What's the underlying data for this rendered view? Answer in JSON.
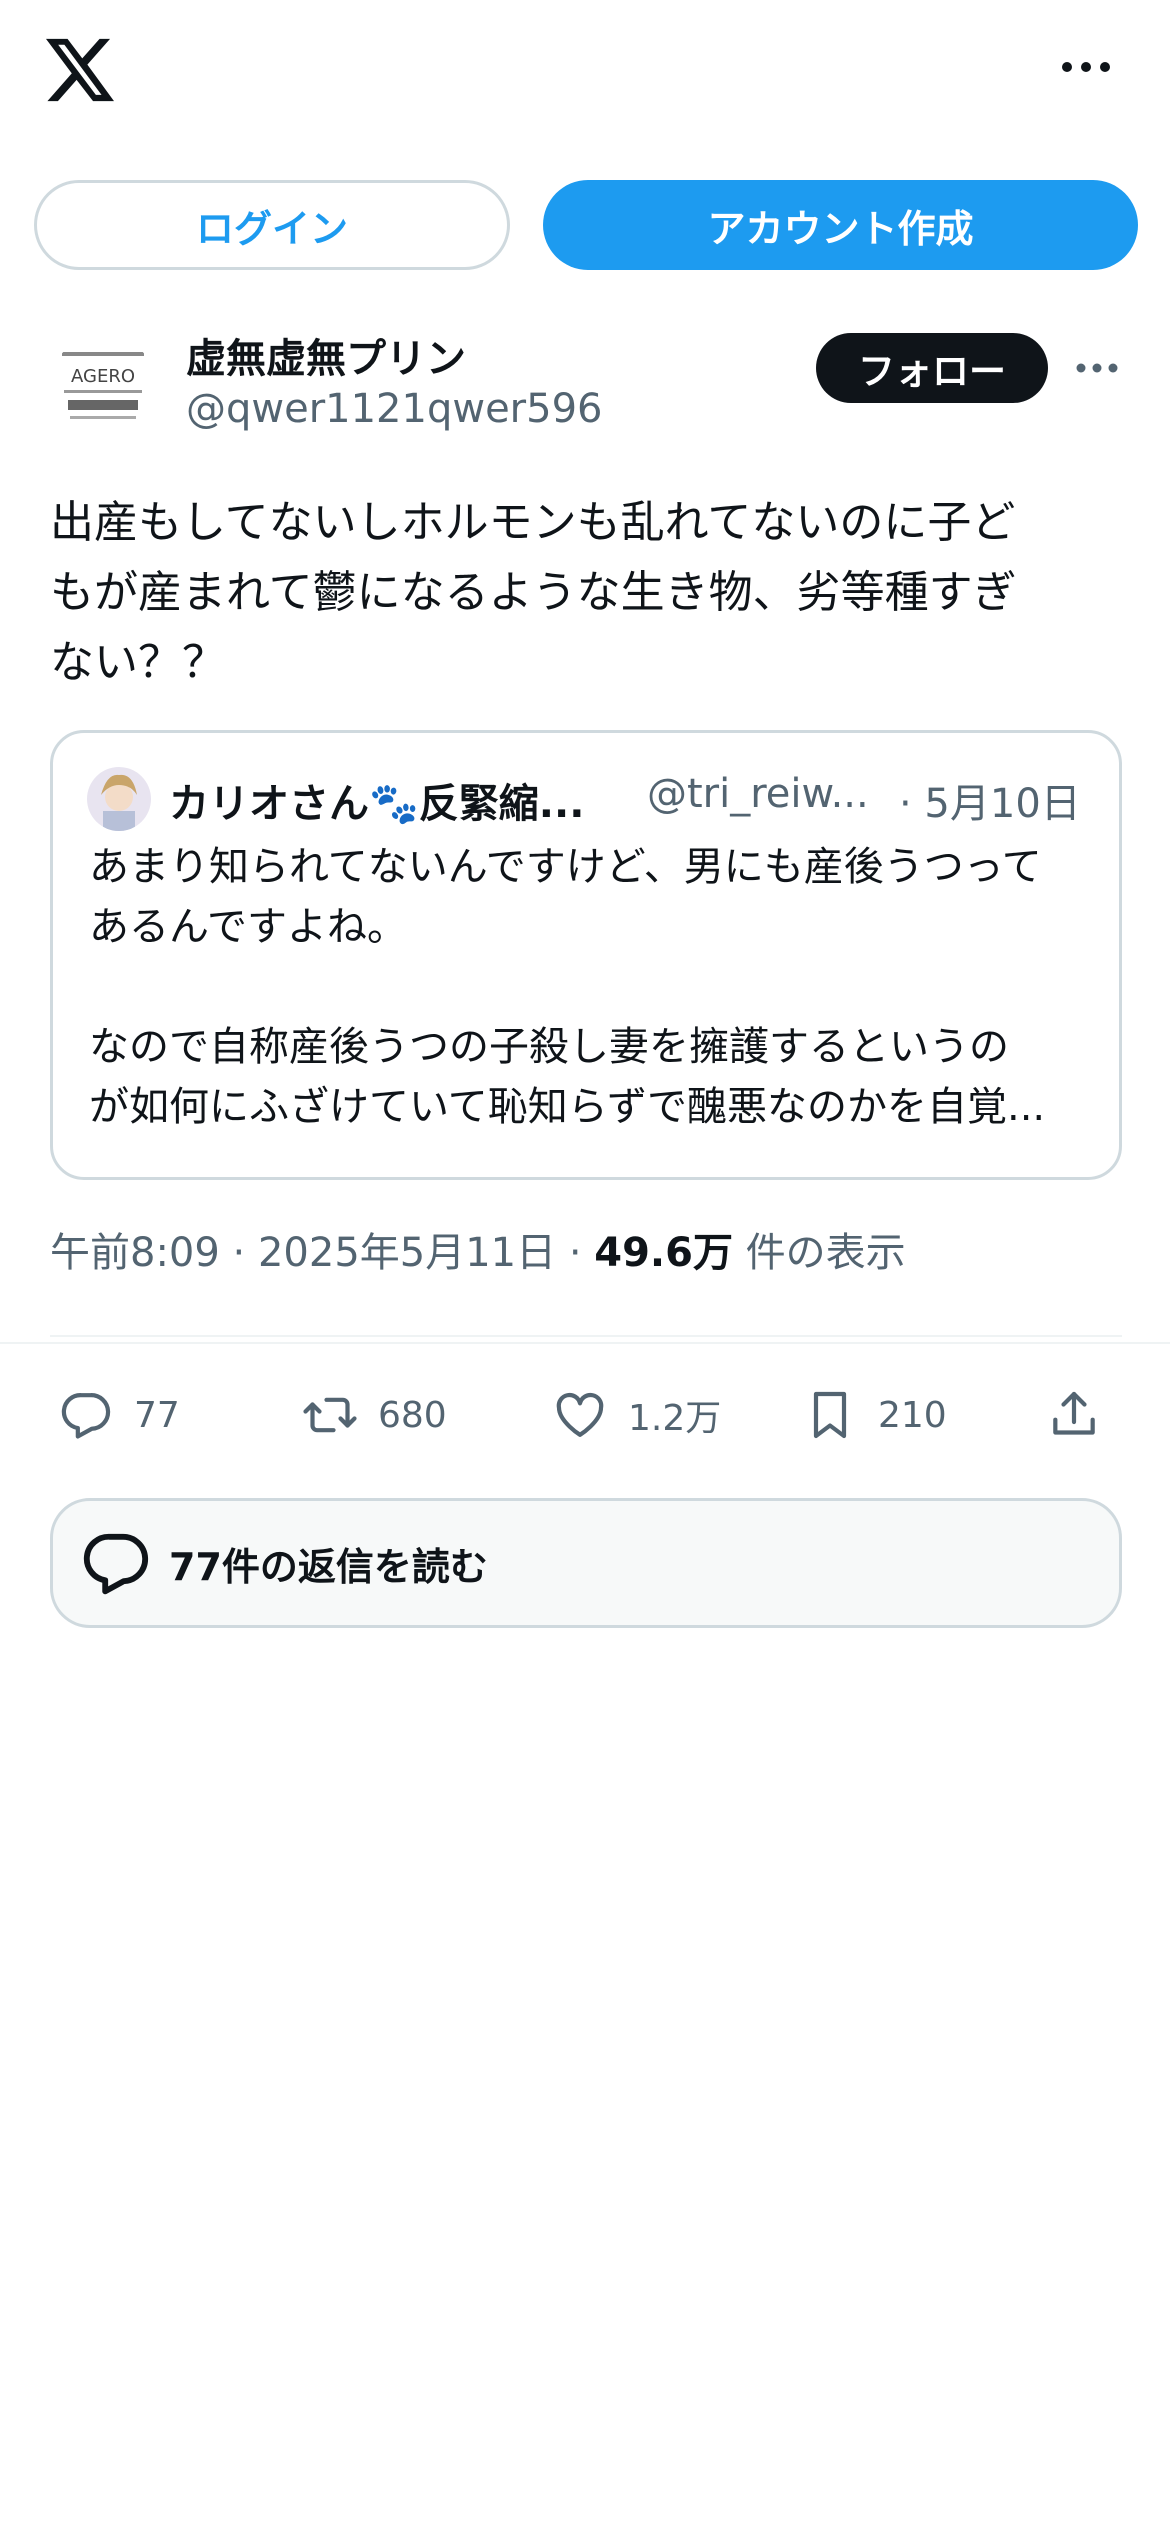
{
  "header": {
    "logo_icon": "x-logo-icon",
    "menu_icon": "more-horizontal-icon"
  },
  "auth": {
    "login_label": "ログイン",
    "signup_label": "アカウント作成"
  },
  "tweet": {
    "avatar_text": "AGERO",
    "author_name": "虚無虚無プリン",
    "author_handle": "@qwer1121qwer596",
    "follow_label": "フォロー",
    "text_lines": [
      "出産もしてないしホルモンも乱れてないのに子ど",
      "もが産まれて鬱になるような生き物、劣等種すぎ",
      "ない？？"
    ],
    "quote": {
      "author_name": "カリオさん🐾反緊縮...",
      "author_handle": "@tri_reiw...",
      "date": "· 5月10日",
      "lines": [
        "あまり知られてないんですけど、男にも産後うつって",
        "あるんですよね。",
        "",
        "なので自称産後うつの子殺し妻を擁護するというの",
        "が如何にふざけていて恥知らずで醜悪なのかを自覚..."
      ]
    },
    "meta": {
      "time": "午前8:09 · 2025年5月11日 · ",
      "views": "49.6万",
      "views_label": " 件の表示"
    },
    "actions": {
      "reply_count": "77",
      "retweet_count": "680",
      "like_count": "1.2万",
      "bookmark_count": "210"
    },
    "read_replies_label": "77件の返信を読む"
  },
  "colors": {
    "accent": "#1d9bf0",
    "text_primary": "#0f1419",
    "text_secondary": "#536471",
    "border": "#cfd9de"
  }
}
